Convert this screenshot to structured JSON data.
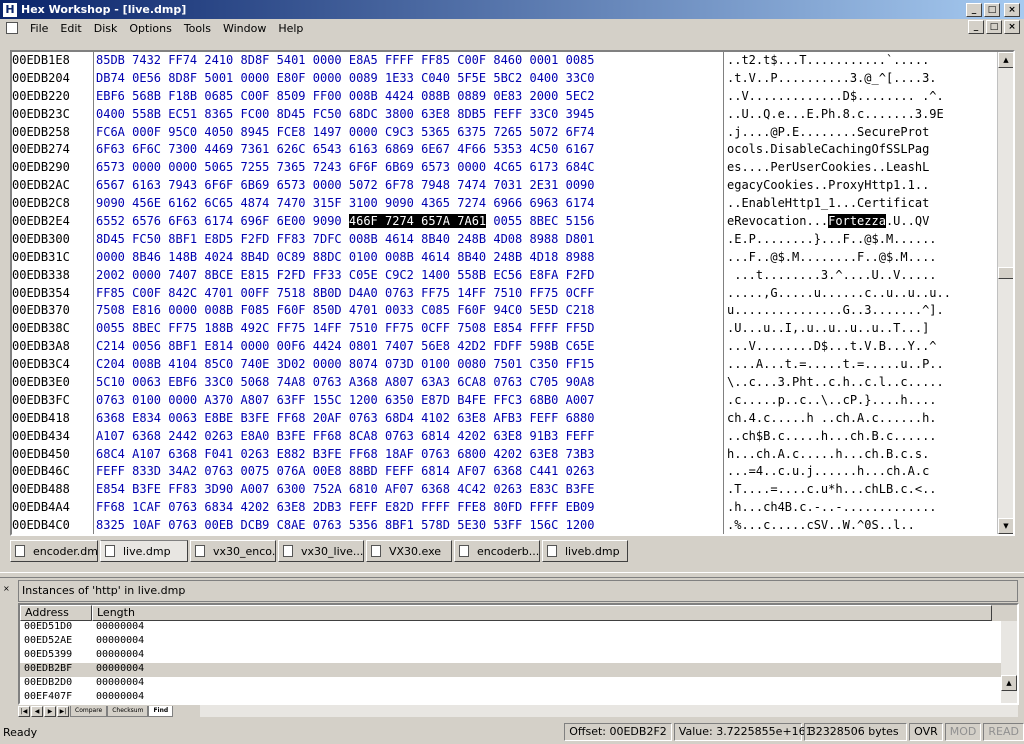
{
  "window": {
    "title": "Hex Workshop - [live.dmp]",
    "app_icon_letter": "H",
    "btn_min": "_",
    "btn_max": "□",
    "btn_close": "×"
  },
  "menu": [
    "File",
    "Edit",
    "Disk",
    "Options",
    "Tools",
    "Window",
    "Help"
  ],
  "hex": {
    "rows": [
      [
        "00EDB1E8",
        "85DB 7432 FF74 2410 8D8F 5401 0000 E8A5 FFFF FF85 C00F 8460 0001 0085",
        "..t2.t$...T...........`....."
      ],
      [
        "00EDB204",
        "DB74 0E56 8D8F 5001 0000 E80F 0000 0089 1E33 C040 5F5E 5BC2 0400 33C0",
        ".t.V..P..........3.@_^[....3."
      ],
      [
        "00EDB220",
        "EBF6 568B F18B 0685 C00F 8509 FF00 008B 4424 088B 0889 0E83 2000 5EC2",
        "..V.............D$........ .^."
      ],
      [
        "00EDB23C",
        "0400 558B EC51 8365 FC00 8D45 FC50 68DC 3800 63E8 8DB5 FEFF 33C0 3945",
        "..U..Q.e...E.Ph.8.c.......3.9E"
      ],
      [
        "00EDB258",
        "FC6A 000F 95C0 4050 8945 FCE8 1497 0000 C9C3 5365 6375 7265 5072 6F74",
        ".j....@P.E........SecureProt"
      ],
      [
        "00EDB274",
        "6F63 6F6C 7300 4469 7361 626C 6543 6163 6869 6E67 4F66 5353 4C50 6167",
        "ocols.DisableCachingOfSSLPag"
      ],
      [
        "00EDB290",
        "6573 0000 0000 5065 7255 7365 7243 6F6F 6B69 6573 0000 4C65 6173 684C",
        "es....PerUserCookies..LeashL"
      ],
      [
        "00EDB2AC",
        "6567 6163 7943 6F6F 6B69 6573 0000 5072 6F78 7948 7474 7031 2E31 0090",
        "egacyCookies..ProxyHttp1.1.."
      ],
      [
        "00EDB2C8",
        "9090 456E 6162 6C65 4874 7470 315F 3100 9090 4365 7274 6966 6963 6174",
        "..EnableHttp1_1...Certificat"
      ],
      [
        "00EDB2E4",
        "6552 6576 6F63 6174 696F 6E00 9090 466F 7274 657A 7A61 0055 8BEC 5156",
        "eRevocation...Fortezza.U..QV"
      ],
      [
        "00EDB300",
        "8D45 FC50 8BF1 E8D5 F2FD FF83 7DFC 008B 4614 8B40 248B 4D08 8988 D801",
        ".E.P........}...F..@$.M......"
      ],
      [
        "00EDB31C",
        "0000 8B46 148B 4024 8B4D 0C89 88DC 0100 008B 4614 8B40 248B 4D18 8988",
        "...F..@$.M........F..@$.M...."
      ],
      [
        "00EDB338",
        "2002 0000 7407 8BCE E815 F2FD FF33 C05E C9C2 1400 558B EC56 E8FA F2FD",
        " ...t........3.^....U..V....."
      ],
      [
        "00EDB354",
        "FF85 C00F 842C 4701 00FF 7518 8B0D D4A0 0763 FF75 14FF 7510 FF75 0CFF",
        ".....,G.....u......c..u..u..u.."
      ],
      [
        "00EDB370",
        "7508 E816 0000 008B F085 F60F 850D 4701 0033 C085 F60F 94C0 5E5D C218",
        "u...............G..3.......^]."
      ],
      [
        "00EDB38C",
        "0055 8BEC FF75 188B 492C FF75 14FF 7510 FF75 0CFF 7508 E854 FFFF FF5D",
        ".U...u..I,.u..u..u..u..T...]"
      ],
      [
        "00EDB3A8",
        "C214 0056 8BF1 E814 0000 00F6 4424 0801 7407 56E8 42D2 FDFF 598B C65E",
        "...V........D$...t.V.B...Y..^"
      ],
      [
        "00EDB3C4",
        "C204 008B 4104 85C0 740E 3D02 0000 8074 073D 0100 0080 7501 C350 FF15",
        "....A...t.=.....t.=.....u..P.."
      ],
      [
        "00EDB3E0",
        "5C10 0063 EBF6 33C0 5068 74A8 0763 A368 A807 63A3 6CA8 0763 C705 90A8",
        "\\..c...3.Pht..c.h..c.l..c....."
      ],
      [
        "00EDB3FC",
        "0763 0100 0000 A370 A807 63FF 155C 1200 6350 E87D B4FE FFC3 68B0 A007",
        ".c.....p..c..\\..cP.}....h...."
      ],
      [
        "00EDB418",
        "6368 E834 0063 E8BE B3FE FF68 20AF 0763 68D4 4102 63E8 AFB3 FEFF 6880",
        "ch.4.c.....h ..ch.A.c......h."
      ],
      [
        "00EDB434",
        "A107 6368 2442 0263 E8A0 B3FE FF68 8CA8 0763 6814 4202 63E8 91B3 FEFF",
        "..ch$B.c.....h...ch.B.c......"
      ],
      [
        "00EDB450",
        "68C4 A107 6368 F041 0263 E882 B3FE FF68 18AF 0763 6800 4202 63E8 73B3",
        "h...ch.A.c.....h...ch.B.c.s."
      ],
      [
        "00EDB46C",
        "FEFF 833D 34A2 0763 0075 076A 00E8 88BD FEFF 6814 AF07 6368 C441 0263",
        "...=4..c.u.j......h...ch.A.c"
      ],
      [
        "00EDB488",
        "E854 B3FE FF83 3D90 A007 6300 752A 6810 AF07 6368 4C42 0263 E83C B3FE",
        ".T....=....c.u*h...chLB.c.<.."
      ],
      [
        "00EDB4A4",
        "FF68 1CAF 0763 6834 4202 63E8 2DB3 FEFF E82D FFFF FFE8 80FD FFFF EB09",
        ".h...ch4B.c.-..-............."
      ],
      [
        "00EDB4C0",
        "8325 10AF 0763 00EB DCB9 C8AE 0763 5356 8BF1 578D 5E30 53FF 156C 1200",
        ".%...c.....cSV..W.^0S..l.."
      ],
      [
        "00EDB4DC",
        "6333 FF8B 0CBE 85C9 0F85 6A01 0100 8B4C BE18 85C9 0F85 6801 0100 4783",
        "c3.........j....L......h...G."
      ],
      [
        "00EDB4F8",
        "FF05 7CE3 6A06 5933 C06A 068B FEF3 AB59 8D7E 1853 F3AB FF15 6812 0063",
        "..|.j.Y3.j.....Y.~.S.....h..c"
      ],
      [
        "00EDB514",
        "5F5E 5BC3 9090 7773 6F63 6B33 3200 6874 4402 63FF 1540 1200 6385 C0A3",
        "_^[...wsock32.htD.c..@...c..."
      ]
    ],
    "sel_row": 9,
    "sel_hex_pre": "6552 6576 6F63 6174 696F 6E00 9090 ",
    "sel_hex": "466F 7274 657A 7A61",
    "sel_hex_post": " 0055 8BEC 5156",
    "sel_asc_pre": "eRevocation...",
    "sel_asc": "Fortezza",
    "sel_asc_post": ".U..QV"
  },
  "tabs": [
    {
      "label": "encoder.dmp",
      "active": false
    },
    {
      "label": "live.dmp",
      "active": true
    },
    {
      "label": "vx30_enco...",
      "active": false
    },
    {
      "label": "vx30_live...",
      "active": false
    },
    {
      "label": "VX30.exe",
      "active": false
    },
    {
      "label": "encoderb...",
      "active": false
    },
    {
      "label": "liveb.dmp",
      "active": false
    }
  ],
  "results": {
    "close_glyph": "×",
    "query": "Instances of 'http' in live.dmp",
    "col_address": "Address",
    "col_length": "Length",
    "rows": [
      [
        "00ED51D0",
        "00000004"
      ],
      [
        "00ED52AE",
        "00000004"
      ],
      [
        "00ED5399",
        "00000004"
      ],
      [
        "00EDB2BF",
        "00000004"
      ],
      [
        "00EDB2D0",
        "00000004"
      ],
      [
        "00EF407F",
        "00000004"
      ]
    ],
    "highlight_row": 3,
    "bottom_tabs": [
      "Compare",
      "Checksum",
      "Find"
    ],
    "active_bottom_tab": "Find"
  },
  "status": {
    "ready": "Ready",
    "offset": "Offset: 00EDB2F2",
    "value": "Value: 3.7225855e+161",
    "size": "32328506 bytes",
    "ovr": "OVR",
    "mod": "MOD",
    "read": "READ"
  }
}
